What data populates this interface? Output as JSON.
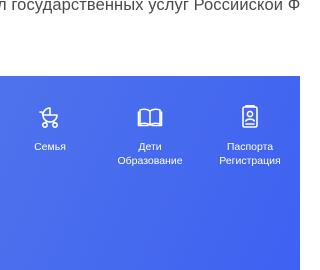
{
  "header": {
    "portal_title": "л государственных услуг Российской Федерации"
  },
  "banner": {
    "background_color": "#476bee",
    "categories": [
      {
        "icon": "stroller-icon",
        "label_line1": "Семья",
        "label_line2": ""
      },
      {
        "icon": "book-icon",
        "label_line1": "Дети",
        "label_line2": "Образование"
      },
      {
        "icon": "passport-icon",
        "label_line1": "Паспорта",
        "label_line2": "Регистрация"
      }
    ]
  }
}
